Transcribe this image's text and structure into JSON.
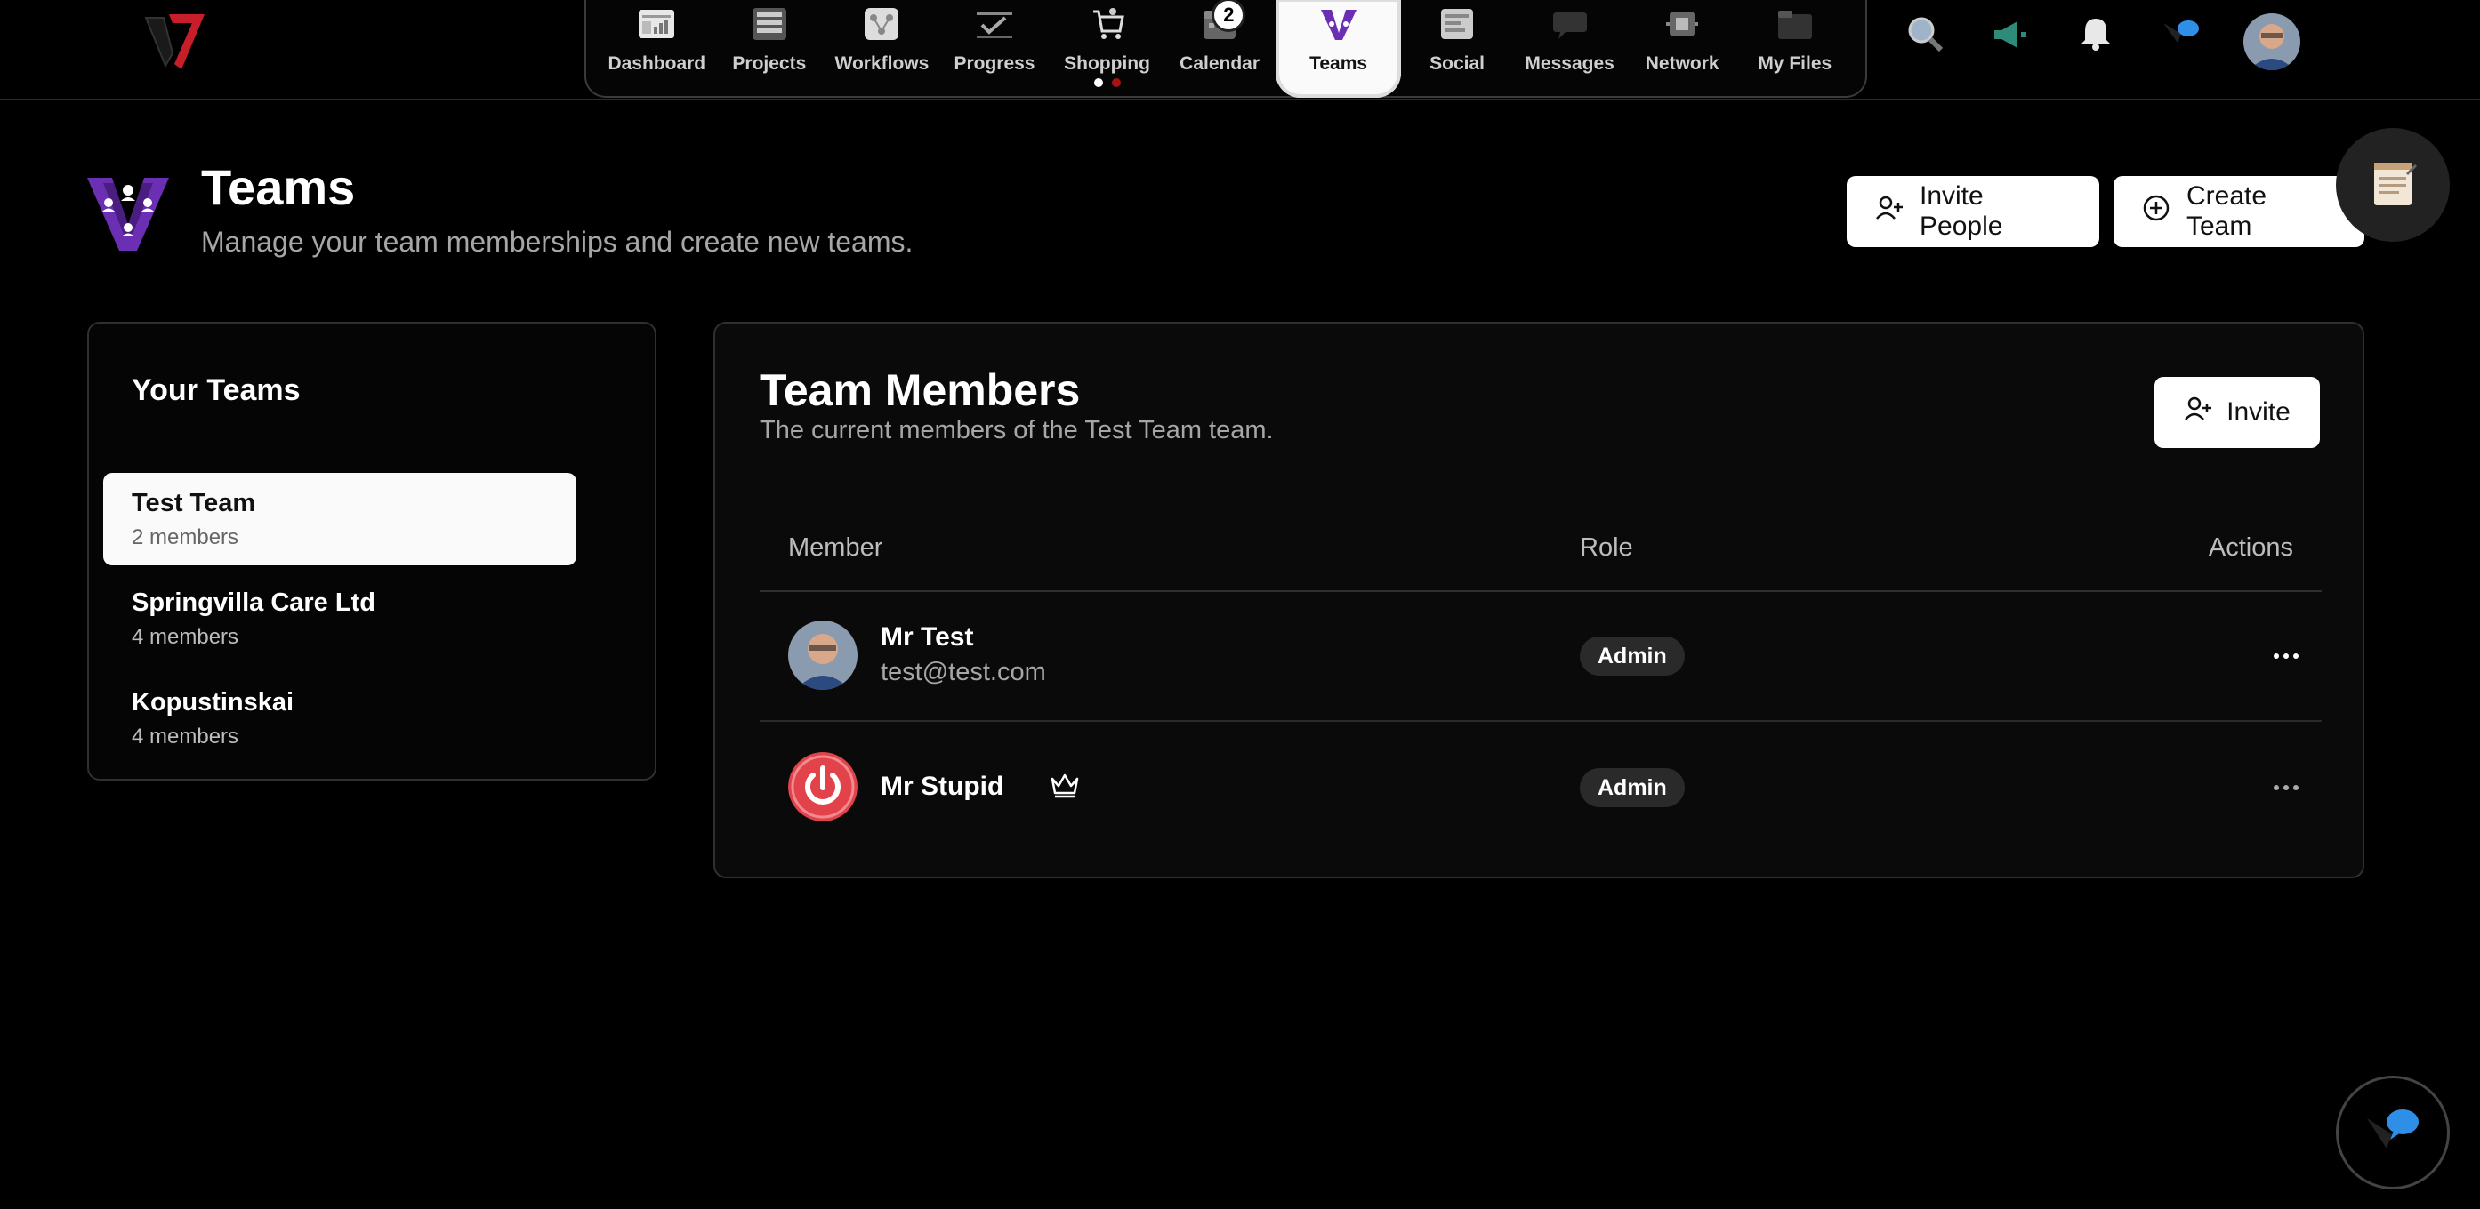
{
  "nav": {
    "items": [
      {
        "label": "Dashboard",
        "icon": "dashboard-icon"
      },
      {
        "label": "Projects",
        "icon": "projects-icon"
      },
      {
        "label": "Workflows",
        "icon": "workflows-icon"
      },
      {
        "label": "Progress",
        "icon": "progress-icon"
      },
      {
        "label": "Shopping",
        "icon": "shopping-cart-icon"
      },
      {
        "label": "Calendar",
        "icon": "calendar-icon",
        "badge": "2"
      },
      {
        "label": "Teams",
        "icon": "teams-icon",
        "active": true
      },
      {
        "label": "Social",
        "icon": "social-icon"
      },
      {
        "label": "Messages",
        "icon": "messages-icon"
      },
      {
        "label": "Network",
        "icon": "network-icon"
      },
      {
        "label": "My Files",
        "icon": "files-icon"
      }
    ]
  },
  "header": {
    "title": "Teams",
    "subtitle": "Manage your team memberships and create new teams.",
    "invite_people_label": "Invite People",
    "create_team_label": "Create Team"
  },
  "your_teams": {
    "title": "Your Teams",
    "teams": [
      {
        "name": "Test Team",
        "count": "2 members",
        "selected": true
      },
      {
        "name": "Springvilla Care Ltd",
        "count": "4 members"
      },
      {
        "name": "Kopustinskai",
        "count": "4 members"
      }
    ]
  },
  "members_panel": {
    "title": "Team Members",
    "subtitle": "The current members of the Test Team team.",
    "invite_label": "Invite",
    "columns": {
      "member": "Member",
      "role": "Role",
      "actions": "Actions"
    },
    "members": [
      {
        "name": "Mr Test",
        "email": "test@test.com",
        "role": "Admin"
      },
      {
        "name": "Mr Stupid",
        "email": "",
        "role": "Admin",
        "owner": true
      }
    ]
  },
  "colors": {
    "accent_purple": "#6b2fb3",
    "logo_red": "#c81e2a",
    "power_red": "#e2424a",
    "bubble_blue": "#2f8fe6"
  }
}
